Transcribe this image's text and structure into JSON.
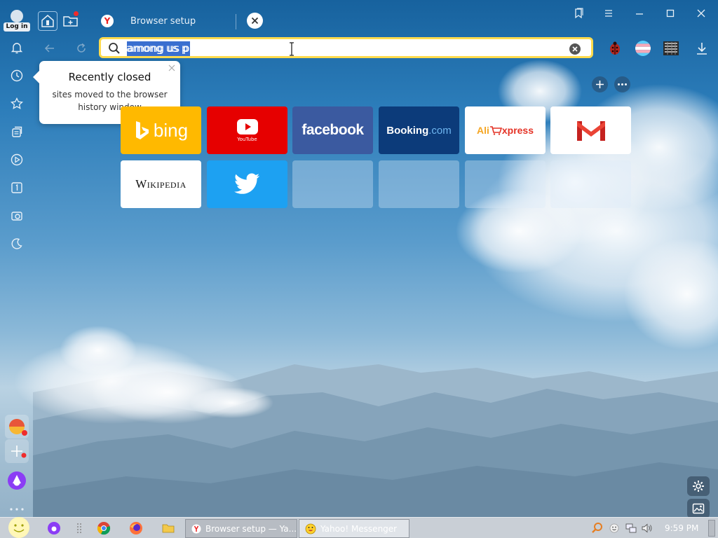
{
  "titlebar": {
    "login_label": "Log in",
    "active_tab_title": "Browser setup"
  },
  "toolbar": {
    "address_value": "among us p"
  },
  "popup": {
    "title": "Recently closed",
    "body": "sites moved to the browser history window"
  },
  "tiles": [
    {
      "label": "bing",
      "bg": "#ffb900",
      "color": "#ffffff"
    },
    {
      "label": "YouTube",
      "bg": "#e60000",
      "color": "#ffffff"
    },
    {
      "label": "facebook",
      "bg": "#3b5aa0",
      "color": "#ffffff"
    },
    {
      "label": "Booking",
      "label2": ".com",
      "bg": "#0c3b7a",
      "color": "#ffffff"
    },
    {
      "label": "Ali",
      "label2": "xpress",
      "bg": "#ffffff",
      "color": "#e43225"
    },
    {
      "label": "",
      "bg": "#ffffff",
      "color": "#d93025"
    },
    {
      "label": "Wikipedia",
      "bg": "#ffffff",
      "color": "#111111"
    },
    {
      "label": "",
      "bg": "#1da1f2",
      "color": "#ffffff"
    }
  ],
  "taskbar": {
    "task_browser": "Browser setup — Ya...",
    "task_messenger": "Yahoo! Messenger",
    "clock": "9:59 PM"
  },
  "colors": {
    "address_border": "#ffdb4d",
    "selection": "#3a6fd0",
    "notification_dot": "#ef2b2b"
  }
}
